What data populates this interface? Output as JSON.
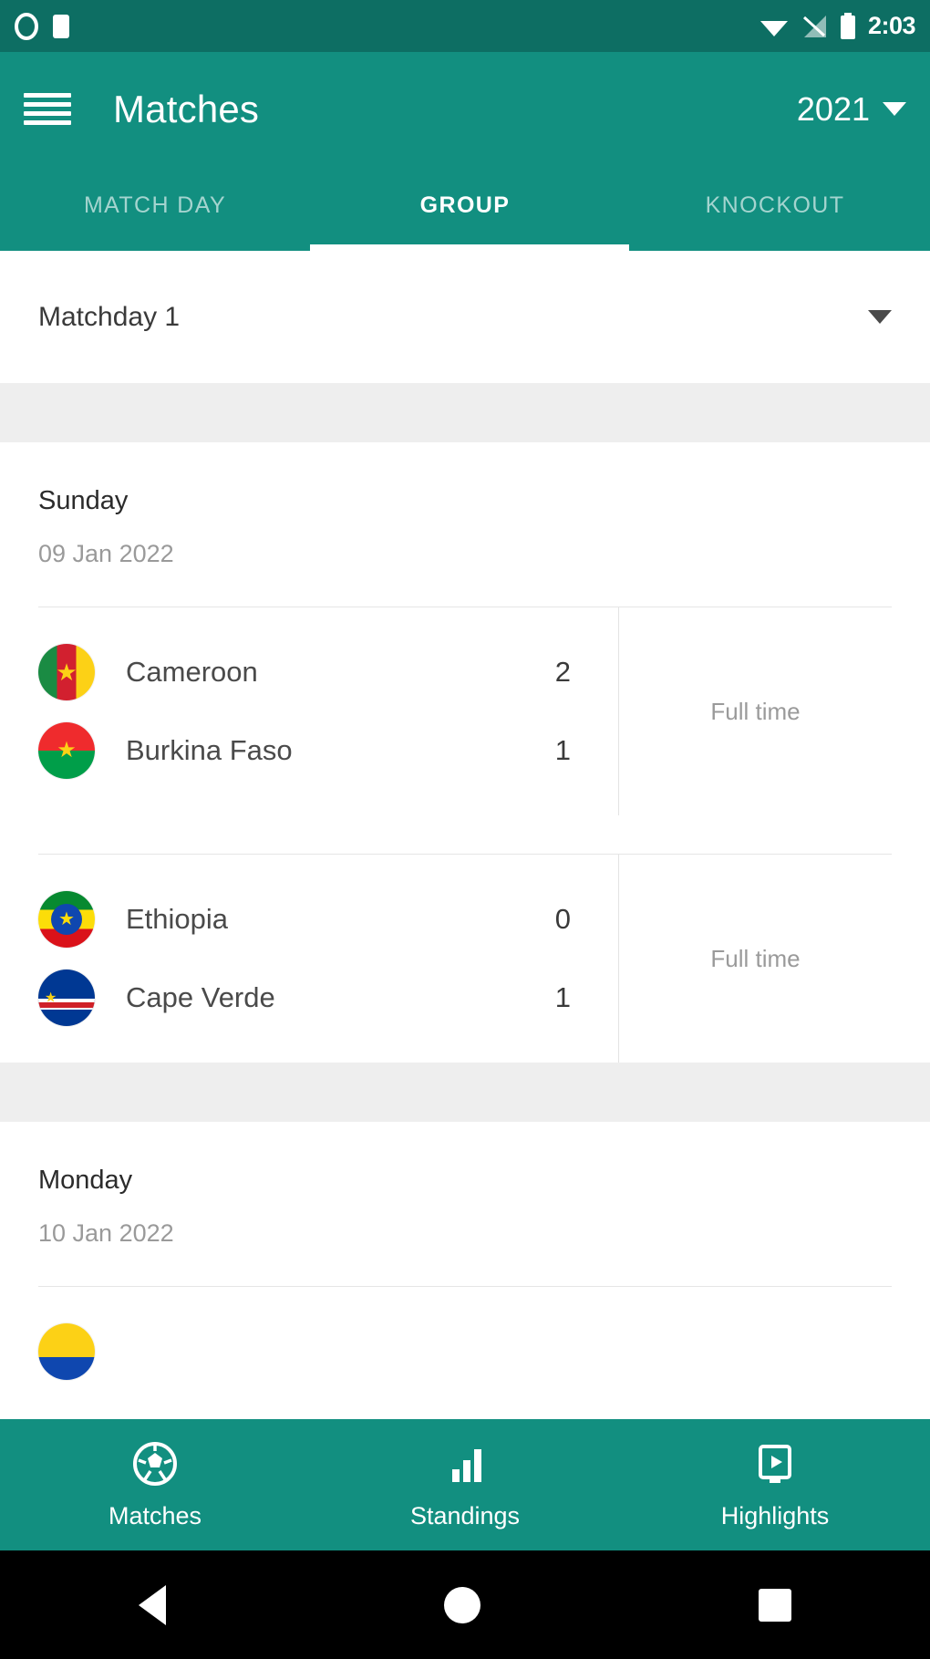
{
  "theme": {
    "primary": "#128F80",
    "primary_dark": "#0D6E63",
    "accent_white": "#FFFFFF",
    "band_grey": "#EEEEEE",
    "muted_text": "#9A9A9A"
  },
  "statusbar": {
    "clock": "2:03",
    "icons": [
      "record-icon",
      "sim-card-icon",
      "wifi-icon",
      "cellular-signal-icon",
      "battery-icon"
    ]
  },
  "appbar": {
    "menu_icon": "hamburger-menu-icon",
    "title": "Matches",
    "season": "2021",
    "season_caret": "chevron-down-icon"
  },
  "tabs": [
    {
      "label": "MATCH DAY",
      "active": false
    },
    {
      "label": "GROUP",
      "active": true
    },
    {
      "label": "KNOCKOUT",
      "active": false
    }
  ],
  "matchday_select": {
    "value": "Matchday 1",
    "caret": "chevron-down-icon"
  },
  "days": [
    {
      "day_name": "Sunday",
      "date": "09 Jan 2022",
      "matches": [
        {
          "status": "Full time",
          "home": {
            "team": "Cameroon",
            "score": "2",
            "flag": "cameroon-flag"
          },
          "away": {
            "team": "Burkina Faso",
            "score": "1",
            "flag": "burkina-faso-flag"
          }
        },
        {
          "status": "Full time",
          "home": {
            "team": "Ethiopia",
            "score": "0",
            "flag": "ethiopia-flag"
          },
          "away": {
            "team": "Cape Verde",
            "score": "1",
            "flag": "cape-verde-flag"
          }
        }
      ]
    },
    {
      "day_name": "Monday",
      "date": "10 Jan 2022",
      "matches": []
    }
  ],
  "bottomnav": [
    {
      "label": "Matches",
      "icon": "soccer-ball-icon",
      "active": true
    },
    {
      "label": "Standings",
      "icon": "bar-chart-icon",
      "active": false
    },
    {
      "label": "Highlights",
      "icon": "video-play-icon",
      "active": false
    }
  ],
  "androidnav": {
    "back": "back-triangle-icon",
    "home": "home-circle-icon",
    "recents": "recents-square-icon"
  }
}
